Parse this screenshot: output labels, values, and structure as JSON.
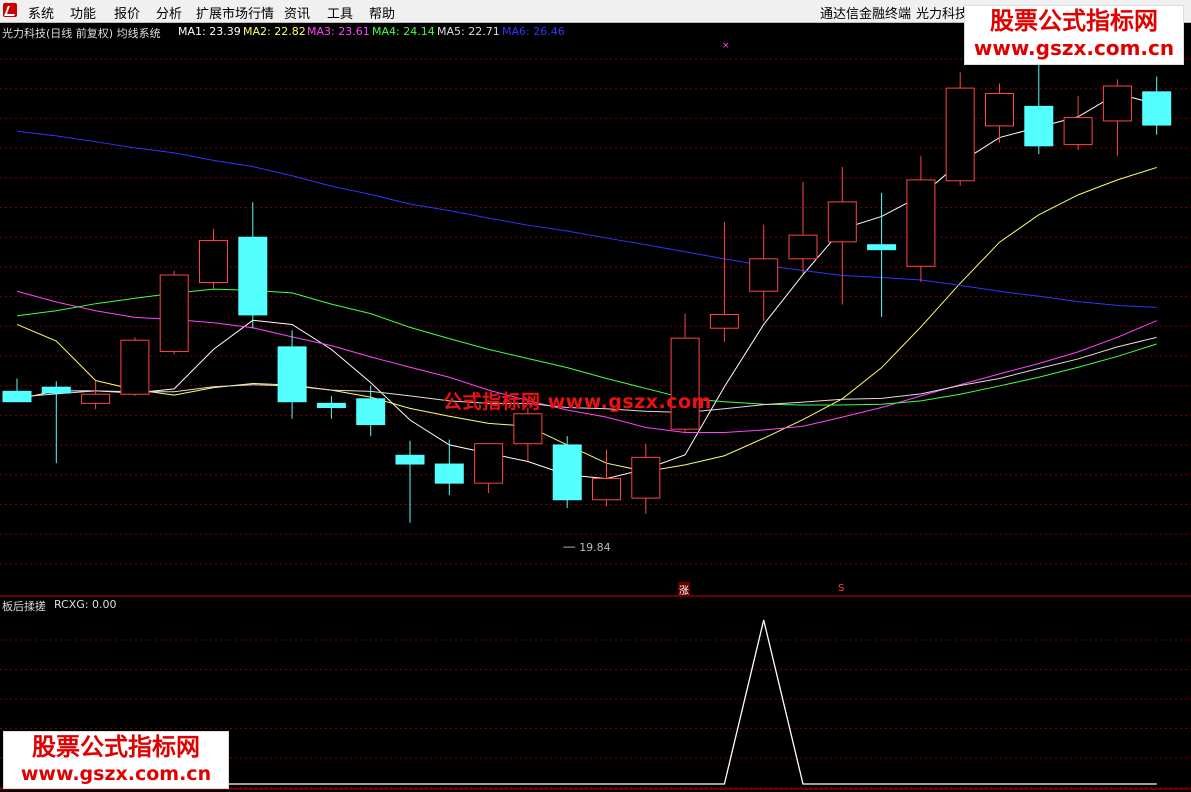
{
  "menu": {
    "items": [
      "系统",
      "功能",
      "报价",
      "分析",
      "扩展市场行情",
      "资讯",
      "工具",
      "帮助"
    ],
    "right_items": [
      "通达信金融终端",
      "光力科技"
    ]
  },
  "header": {
    "title": "光力科技(日线 前复权) 均线系统",
    "ma_values": [
      {
        "label": "MA1: 23.39",
        "color": "#ffffff"
      },
      {
        "label": "MA2: 22.82",
        "color": "#ffff66"
      },
      {
        "label": "MA3: 23.61",
        "color": "#ff44ff"
      },
      {
        "label": "MA4: 24.14",
        "color": "#44ff44"
      },
      {
        "label": "MA5: 22.71",
        "color": "#dddddd"
      },
      {
        "label": "MA6: 26.46",
        "color": "#3333ff"
      }
    ]
  },
  "lower_header": {
    "title": "板后揉搓",
    "value": "RCXG: 0.00"
  },
  "low_marker": "19.84",
  "zhang_marker": "涨",
  "s_marker": "S",
  "watermark": {
    "top_line1": "股票公式指标网",
    "top_line2": "www.gszx.com.cn",
    "center": "公式指标网  www.gszx.com",
    "bottom_line1": "股票公式指标网",
    "bottom_line2": "www.gszx.com.cn"
  },
  "colors": {
    "up": "#ff4444",
    "down": "#54ffff",
    "grid": "#7a0000",
    "divider": "#cc0000"
  },
  "chart_data": {
    "type": "candlestick",
    "price_range": [
      19.0,
      32.0
    ],
    "candles": [
      {
        "o": 23.59,
        "h": 23.9,
        "l": 23.37,
        "c": 23.34,
        "dir": "down"
      },
      {
        "o": 23.69,
        "h": 23.83,
        "l": 21.86,
        "c": 23.55,
        "dir": "down"
      },
      {
        "o": 23.3,
        "h": 23.83,
        "l": 23.16,
        "c": 23.52,
        "dir": "up"
      },
      {
        "o": 23.52,
        "h": 24.89,
        "l": 23.48,
        "c": 24.82,
        "dir": "up"
      },
      {
        "o": 24.55,
        "h": 26.49,
        "l": 24.48,
        "c": 26.39,
        "dir": "up"
      },
      {
        "o": 26.21,
        "h": 27.5,
        "l": 26.07,
        "c": 27.22,
        "dir": "up"
      },
      {
        "o": 27.3,
        "h": 28.14,
        "l": 25.1,
        "c": 25.43,
        "dir": "down"
      },
      {
        "o": 24.66,
        "h": 25.06,
        "l": 22.93,
        "c": 23.34,
        "dir": "down"
      },
      {
        "o": 23.3,
        "h": 23.48,
        "l": 22.93,
        "c": 23.2,
        "dir": "down"
      },
      {
        "o": 23.41,
        "h": 23.73,
        "l": 22.51,
        "c": 22.79,
        "dir": "down"
      },
      {
        "o": 22.05,
        "h": 22.4,
        "l": 20.43,
        "c": 21.84,
        "dir": "down"
      },
      {
        "o": 21.84,
        "h": 22.43,
        "l": 21.09,
        "c": 21.38,
        "dir": "down"
      },
      {
        "o": 21.38,
        "h": 22.33,
        "l": 21.14,
        "c": 22.33,
        "dir": "up"
      },
      {
        "o": 22.33,
        "h": 23.2,
        "l": 21.91,
        "c": 23.05,
        "dir": "up"
      },
      {
        "o": 22.3,
        "h": 22.51,
        "l": 20.78,
        "c": 20.98,
        "dir": "down"
      },
      {
        "o": 20.98,
        "h": 22.19,
        "l": 20.82,
        "c": 21.49,
        "dir": "up"
      },
      {
        "o": 21.02,
        "h": 22.33,
        "l": 20.64,
        "c": 22.0,
        "dir": "up"
      },
      {
        "o": 22.68,
        "h": 25.46,
        "l": 22.61,
        "c": 24.87,
        "dir": "up"
      },
      {
        "o": 25.11,
        "h": 27.67,
        "l": 24.78,
        "c": 25.44,
        "dir": "up"
      },
      {
        "o": 26.0,
        "h": 27.6,
        "l": 25.28,
        "c": 26.78,
        "dir": "up"
      },
      {
        "o": 26.78,
        "h": 28.63,
        "l": 26.43,
        "c": 27.35,
        "dir": "up"
      },
      {
        "o": 27.19,
        "h": 28.99,
        "l": 25.68,
        "c": 28.15,
        "dir": "up"
      },
      {
        "o": 27.12,
        "h": 28.37,
        "l": 25.38,
        "c": 27.0,
        "dir": "down"
      },
      {
        "o": 26.6,
        "h": 29.26,
        "l": 26.22,
        "c": 28.68,
        "dir": "up"
      },
      {
        "o": 28.66,
        "h": 31.27,
        "l": 28.54,
        "c": 30.89,
        "dir": "up"
      },
      {
        "o": 29.98,
        "h": 31.0,
        "l": 29.58,
        "c": 30.76,
        "dir": "up"
      },
      {
        "o": 30.45,
        "h": 31.47,
        "l": 29.3,
        "c": 29.5,
        "dir": "down"
      },
      {
        "o": 29.53,
        "h": 30.7,
        "l": 29.4,
        "c": 30.18,
        "dir": "up"
      },
      {
        "o": 30.1,
        "h": 31.1,
        "l": 29.25,
        "c": 30.94,
        "dir": "up"
      },
      {
        "o": 30.8,
        "h": 31.17,
        "l": 29.77,
        "c": 30.0,
        "dir": "down"
      }
    ],
    "ma_lines": {
      "MA1": [
        23.4,
        23.6,
        23.6,
        23.55,
        23.65,
        24.6,
        25.3,
        25.2,
        24.6,
        23.8,
        22.9,
        22.3,
        22.1,
        21.9,
        21.58,
        21.49,
        21.72,
        22.06,
        23.7,
        25.2,
        26.4,
        27.5,
        27.8,
        28.3,
        29.1,
        29.7,
        29.95,
        30.2,
        30.76,
        30.5
      ],
      "MA2": [
        25.2,
        24.8,
        23.85,
        23.63,
        23.5,
        23.68,
        23.78,
        23.74,
        23.62,
        23.45,
        23.18,
        22.99,
        22.82,
        22.75,
        22.3,
        21.86,
        21.66,
        21.82,
        22.04,
        22.46,
        22.91,
        23.41,
        24.16,
        25.14,
        26.19,
        27.18,
        27.84,
        28.32,
        28.68,
        28.98
      ],
      "MA3": [
        26.0,
        25.74,
        25.53,
        25.37,
        25.32,
        25.24,
        25.12,
        24.9,
        24.69,
        24.42,
        24.17,
        23.93,
        23.62,
        23.37,
        23.14,
        22.97,
        22.72,
        22.6,
        22.6,
        22.66,
        22.75,
        22.97,
        23.2,
        23.48,
        23.75,
        24.01,
        24.26,
        24.54,
        24.89,
        25.29
      ],
      "MA4": [
        25.41,
        25.53,
        25.7,
        25.83,
        25.95,
        26.05,
        26.02,
        25.96,
        25.69,
        25.46,
        25.13,
        24.86,
        24.6,
        24.38,
        24.16,
        23.9,
        23.66,
        23.42,
        23.34,
        23.28,
        23.26,
        23.26,
        23.28,
        23.36,
        23.52,
        23.72,
        23.93,
        24.17,
        24.43,
        24.73
      ],
      "MA5": [
        23.45,
        23.53,
        23.6,
        23.58,
        23.58,
        23.7,
        23.75,
        23.72,
        23.62,
        23.59,
        23.48,
        23.36,
        23.3,
        23.3,
        23.2,
        23.17,
        23.11,
        23.08,
        23.17,
        23.27,
        23.33,
        23.4,
        23.42,
        23.53,
        23.73,
        23.9,
        24.14,
        24.37,
        24.66,
        24.89
      ],
      "MA6": [
        29.85,
        29.74,
        29.6,
        29.45,
        29.33,
        29.15,
        29.0,
        28.78,
        28.53,
        28.33,
        28.1,
        27.94,
        27.76,
        27.59,
        27.45,
        27.28,
        27.12,
        26.95,
        26.78,
        26.62,
        26.5,
        26.38,
        26.33,
        26.27,
        26.14,
        26.0,
        25.88,
        25.75,
        25.66,
        25.61
      ]
    },
    "indicator": {
      "name": "RCXG",
      "values": [
        0,
        0,
        0,
        0,
        0,
        0,
        0,
        0,
        0,
        0,
        0,
        0,
        0,
        0,
        0,
        0,
        0,
        0,
        0,
        1,
        0,
        0,
        0,
        0,
        0,
        0,
        0,
        0,
        0,
        0
      ],
      "range": [
        0,
        1
      ]
    }
  }
}
